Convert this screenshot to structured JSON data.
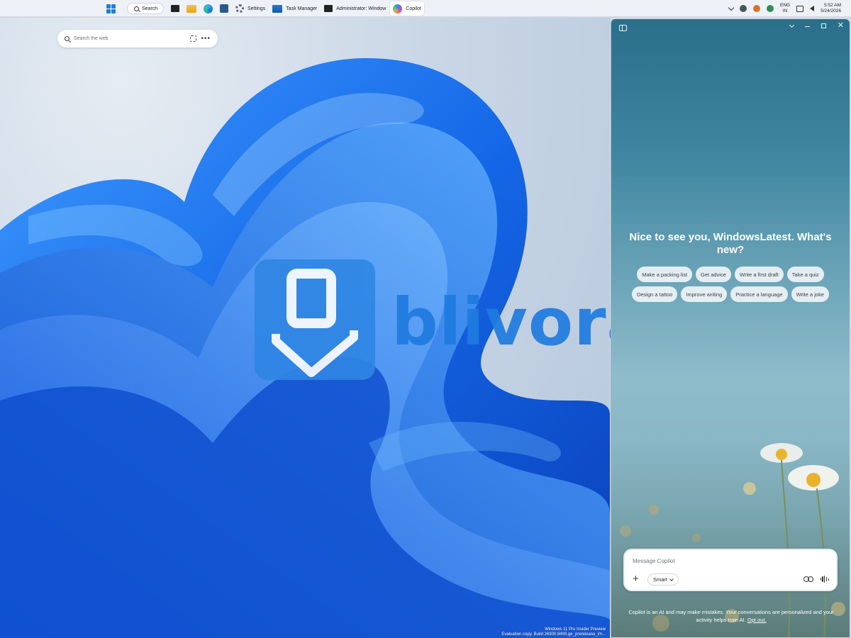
{
  "taskbar": {
    "search_label": "Search",
    "apps": [
      {
        "label": "Settings"
      },
      {
        "label": "Task Manager"
      },
      {
        "label": "Administrator: Window"
      },
      {
        "label": "Copilot"
      }
    ],
    "tray": {
      "lang_top": "ENG",
      "lang_bottom": "IN",
      "time": "5:52 AM",
      "date": "5/24/2026"
    }
  },
  "desktop": {
    "web_search_placeholder": "Search the web",
    "eval_line1": "Windows 11 Pro Insider Preview",
    "eval_line2": "Evaluation copy. Build 26300.8493.ge_prerelease_im..."
  },
  "watermark": {
    "brand": "blivora"
  },
  "copilot": {
    "greeting": "Nice to see you, WindowsLatest. What's new?",
    "suggestions": [
      "Make a packing list",
      "Get advice",
      "Write a first draft",
      "Take a quiz",
      "Design a tattoo",
      "Improve writing",
      "Practice a language",
      "Write a joke"
    ],
    "composer": {
      "placeholder": "Message Copilot",
      "mode_label": "Smart"
    },
    "disclaimer_text": "Copilot is an AI and may make mistakes. Your conversations are personalized and your activity helps train AI.",
    "opt_out_label": "Opt out."
  },
  "colors": {
    "accent": "#1f7be0",
    "panel_top": "#2a6f8a",
    "taskbar_bg": "#eef1f6"
  }
}
